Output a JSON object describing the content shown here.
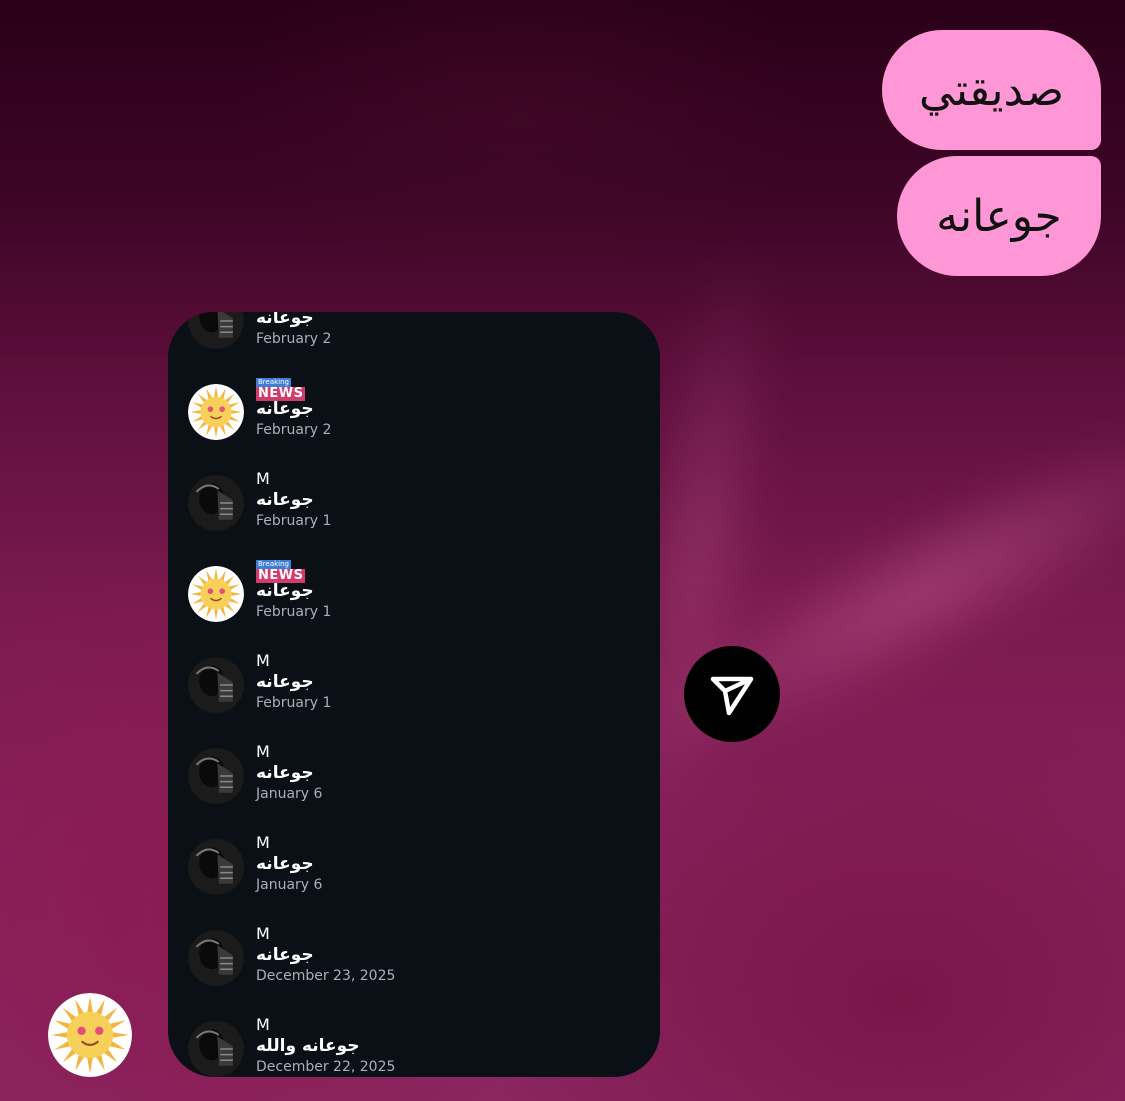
{
  "bubbles": [
    {
      "text": "صديقتي"
    },
    {
      "text": "جوعانه"
    }
  ],
  "replies": [
    {
      "sender": "...",
      "badge": false,
      "text": "جوعانه",
      "date": "February 2",
      "avatar": "dark-avatar"
    },
    {
      "sender": "",
      "badge": true,
      "text": "جوعانه",
      "date": "February 2",
      "avatar": "sun-avatar"
    },
    {
      "sender": "M",
      "badge": false,
      "text": "جوعانه",
      "date": "February 1",
      "avatar": "dark-avatar"
    },
    {
      "sender": "",
      "badge": true,
      "text": "جوعانه",
      "date": "February 1",
      "avatar": "sun-avatar"
    },
    {
      "sender": "M",
      "badge": false,
      "text": "جوعانه",
      "date": "February 1",
      "avatar": "dark-avatar"
    },
    {
      "sender": "M",
      "badge": false,
      "text": "جوعانه",
      "date": "January 6",
      "avatar": "dark-avatar"
    },
    {
      "sender": "M",
      "badge": false,
      "text": "جوعانه",
      "date": "January 6",
      "avatar": "dark-avatar"
    },
    {
      "sender": "M",
      "badge": false,
      "text": "جوعانه",
      "date": "December 23, 2025",
      "avatar": "dark-avatar"
    },
    {
      "sender": "M",
      "badge": false,
      "text": "جوعانه والله",
      "date": "December 22, 2025",
      "avatar": "dark-avatar"
    }
  ],
  "news_badge": {
    "top": "Breaking",
    "bottom": "NEWS"
  },
  "fab": {
    "icon": "send-icon"
  },
  "colors": {
    "bubble": "#ff96d6",
    "panel": "#0a1016",
    "date": "#a9b0b8"
  }
}
